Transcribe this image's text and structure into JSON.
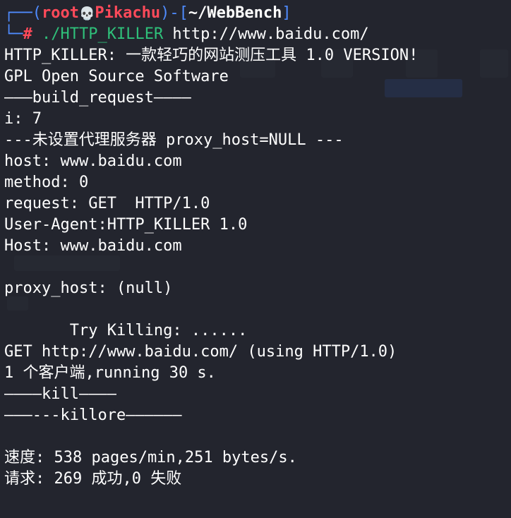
{
  "prompt": {
    "open": "┌──(",
    "user": "root",
    "skull": "💀",
    "host": "Pikachu",
    "mid": ")-[",
    "cwd": "~/WebBench",
    "close": "]",
    "corner": "└─",
    "hash": "#",
    "command": "./HTTP_KILLER",
    "argument": " http://www.baidu.com/"
  },
  "output": [
    "HTTP_KILLER: 一款轻巧的网站测压工具 1.0 VERSION!",
    "GPL Open Source Software",
    "———build_request————",
    "i: 7",
    "---未设置代理服务器 proxy_host=NULL ---",
    "host: www.baidu.com",
    "method: 0",
    "request: GET  HTTP/1.0",
    "User-Agent:HTTP_KILLER 1.0",
    "Host: www.baidu.com",
    "",
    "proxy_host: (null)",
    "",
    "       Try Killing: ......",
    "GET http://www.baidu.com/ (using HTTP/1.0)",
    "1 个客户端,running 30 s.",
    "————kill————",
    "———---killore——————",
    "",
    "速度: 538 pages/min,251 bytes/s.",
    "请求: 269 成功,0 失败"
  ],
  "colors": {
    "background": "#23252e",
    "prompt_frame": "#4f8cff",
    "prompt_user": "#ff4a5a",
    "command": "#2fc07a",
    "text": "#ffffff"
  }
}
